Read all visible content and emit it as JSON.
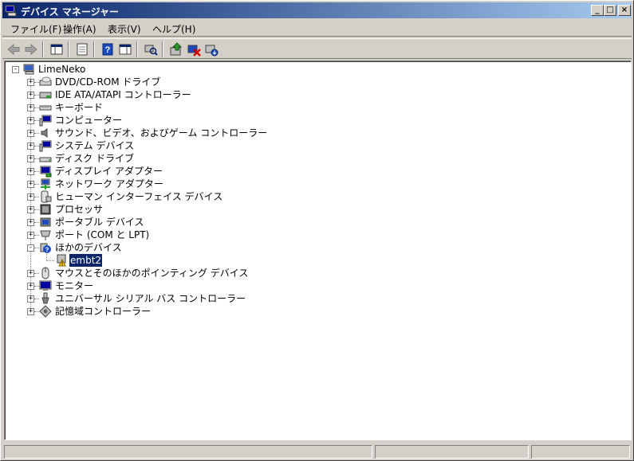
{
  "window": {
    "title": "デバイス マネージャー",
    "min_label": "_",
    "max_label": "□",
    "close_label": "×"
  },
  "menu": [
    {
      "label": "ファイル(F)"
    },
    {
      "label": "操作(A)"
    },
    {
      "label": "表示(V)"
    },
    {
      "label": "ヘルプ(H)"
    }
  ],
  "toolbar": {
    "buttons": [
      "back",
      "forward",
      "show-hide-console-tree",
      "properties",
      "help",
      "action-pane",
      "scan-hardware",
      "update-driver",
      "uninstall",
      "disable"
    ]
  },
  "tree": {
    "root": {
      "label": "LimeNeko",
      "expanded": true
    },
    "categories": [
      {
        "label": "DVD/CD-ROM ドライブ",
        "icon": "cdrom-icon",
        "expanded": false
      },
      {
        "label": "IDE ATA/ATAPI コントローラー",
        "icon": "ide-controller-icon",
        "expanded": false
      },
      {
        "label": "キーボード",
        "icon": "keyboard-icon",
        "expanded": false
      },
      {
        "label": "コンピューター",
        "icon": "computer-icon",
        "expanded": false
      },
      {
        "label": "サウンド、ビデオ、およびゲーム コントローラー",
        "icon": "sound-icon",
        "expanded": false
      },
      {
        "label": "システム デバイス",
        "icon": "system-device-icon",
        "expanded": false
      },
      {
        "label": "ディスク ドライブ",
        "icon": "disk-drive-icon",
        "expanded": false
      },
      {
        "label": "ディスプレイ アダプター",
        "icon": "display-adapter-icon",
        "expanded": false
      },
      {
        "label": "ネットワーク アダプター",
        "icon": "network-adapter-icon",
        "expanded": false
      },
      {
        "label": "ヒューマン インターフェイス デバイス",
        "icon": "hid-icon",
        "expanded": false
      },
      {
        "label": "プロセッサ",
        "icon": "processor-icon",
        "expanded": false
      },
      {
        "label": "ポータブル デバイス",
        "icon": "portable-device-icon",
        "expanded": false
      },
      {
        "label": "ポート (COM と LPT)",
        "icon": "port-icon",
        "expanded": false
      },
      {
        "label": "ほかのデバイス",
        "icon": "unknown-device-icon",
        "expanded": true,
        "children": [
          {
            "label": "embt2",
            "icon": "warning-device-icon",
            "selected": true
          }
        ]
      },
      {
        "label": "マウスとそのほかのポインティング デバイス",
        "icon": "mouse-icon",
        "expanded": false
      },
      {
        "label": "モニター",
        "icon": "monitor-icon",
        "expanded": false
      },
      {
        "label": "ユニバーサル シリアル バス コントローラー",
        "icon": "usb-icon",
        "expanded": false
      },
      {
        "label": "記憶域コントローラー",
        "icon": "storage-controller-icon",
        "expanded": false
      }
    ]
  },
  "colors": {
    "titlebar_start": "#0a246a",
    "titlebar_end": "#a6caf0",
    "selection": "#0a246a",
    "chrome": "#d4d0c8"
  }
}
